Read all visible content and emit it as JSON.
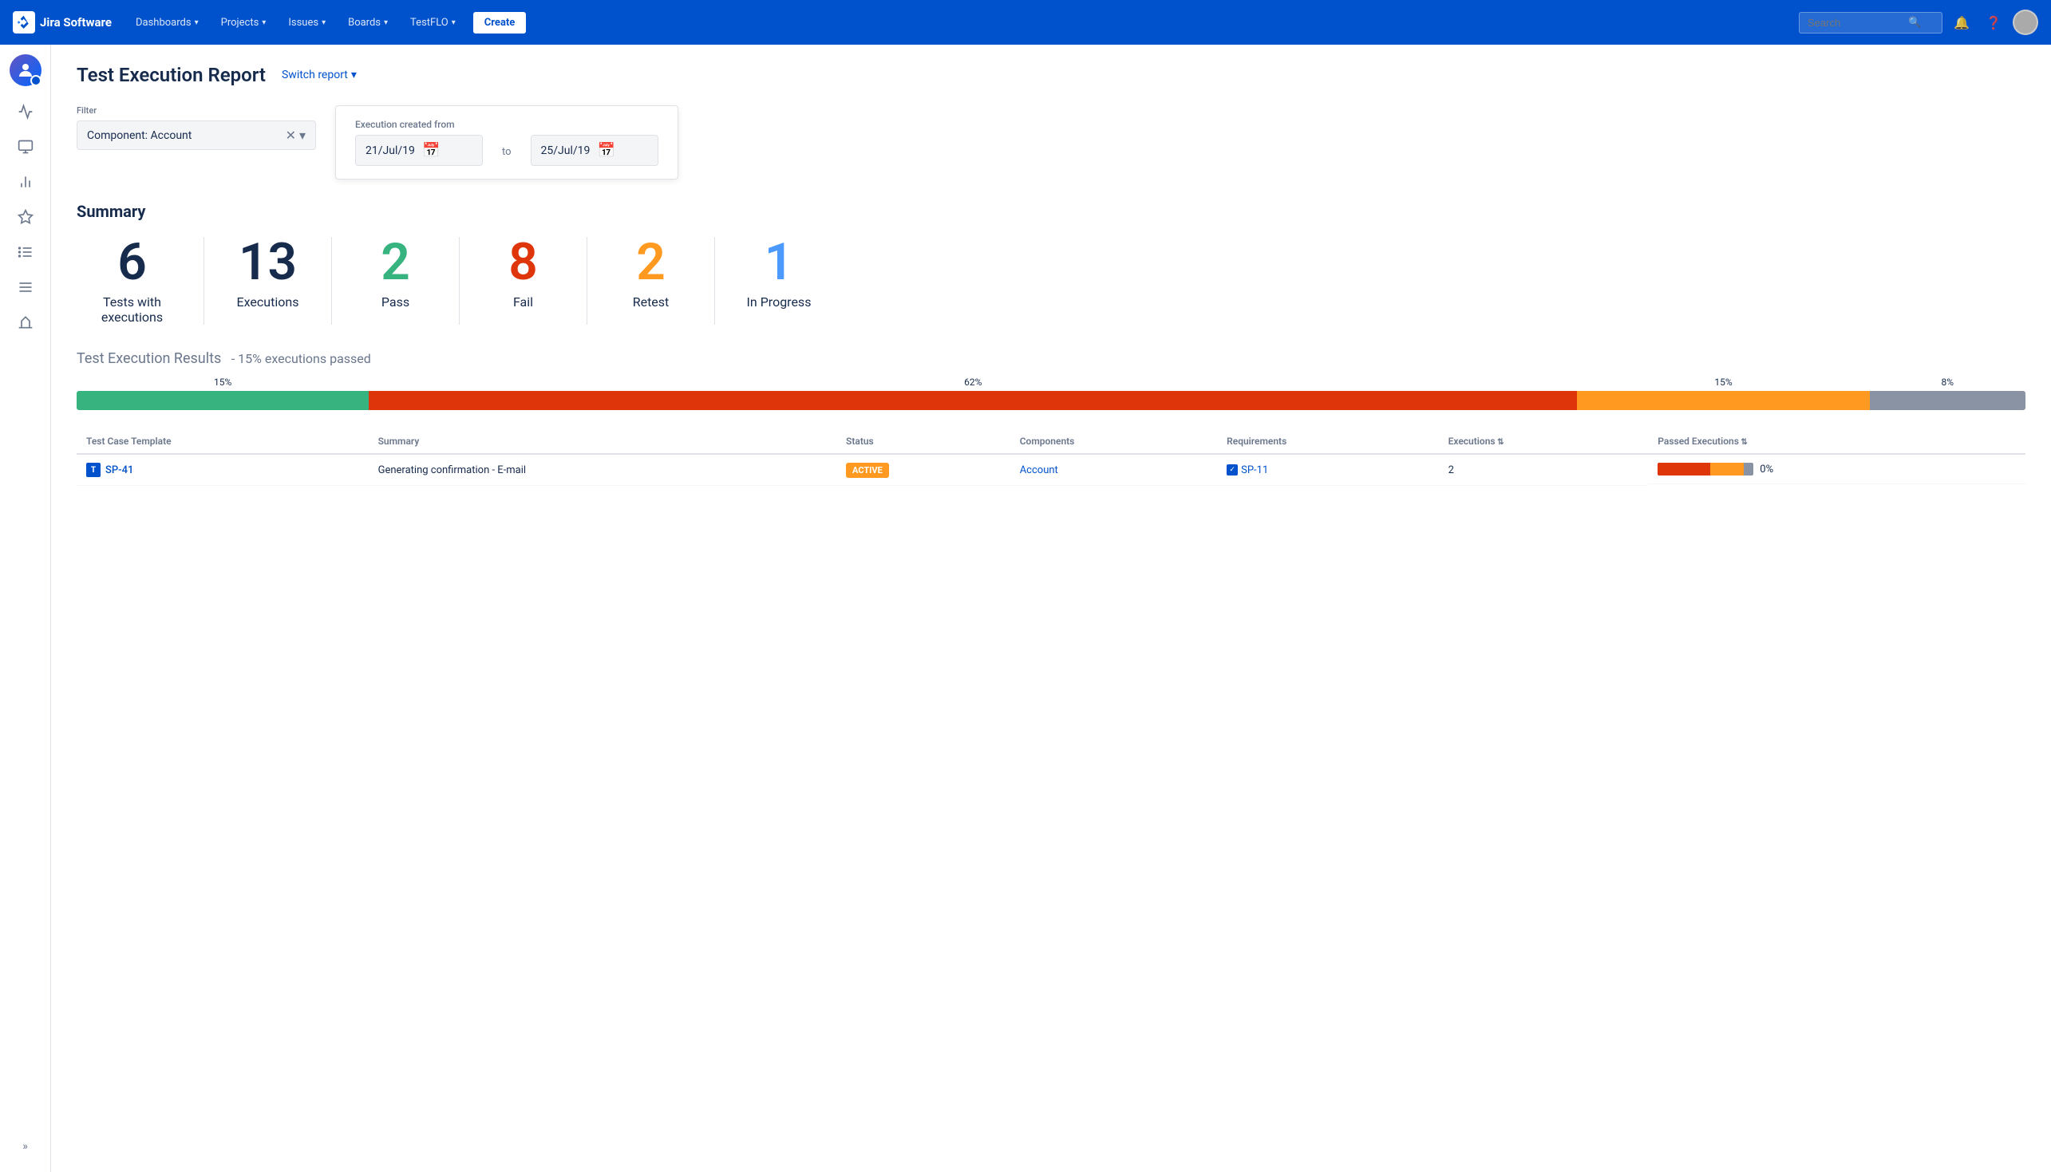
{
  "nav": {
    "logo_text": "Jira Software",
    "items": [
      {
        "label": "Dashboards",
        "has_chevron": true
      },
      {
        "label": "Projects",
        "has_chevron": true
      },
      {
        "label": "Issues",
        "has_chevron": true
      },
      {
        "label": "Boards",
        "has_chevron": true
      },
      {
        "label": "TestFLO",
        "has_chevron": true
      }
    ],
    "create_label": "Create",
    "search_placeholder": "Search"
  },
  "sidebar": {
    "items": [
      {
        "icon": "⚡",
        "label": "activity"
      },
      {
        "icon": "🖥",
        "label": "board"
      },
      {
        "icon": "📈",
        "label": "reports"
      },
      {
        "icon": "🔷",
        "label": "plans"
      },
      {
        "icon": "📊",
        "label": "backlog"
      },
      {
        "icon": "☰",
        "label": "issues"
      },
      {
        "icon": "🏗",
        "label": "deployments"
      }
    ],
    "expand_label": "»"
  },
  "page": {
    "title": "Test Execution Report",
    "switch_report_label": "Switch report",
    "chevron": "▾"
  },
  "filter": {
    "label": "Filter",
    "value": "Component: Account",
    "placeholder": "Component: Account"
  },
  "date_range": {
    "from_label": "Execution created from",
    "from_value": "21/Jul/19",
    "to_label": "to",
    "to_value": "25/Jul/19",
    "calendar_icon": "📅"
  },
  "summary": {
    "title": "Summary",
    "stats": [
      {
        "number": "6",
        "label": "Tests with\nexecutions",
        "color": "black"
      },
      {
        "number": "13",
        "label": "Executions",
        "color": "black"
      },
      {
        "number": "2",
        "label": "Pass",
        "color": "green"
      },
      {
        "number": "8",
        "label": "Fail",
        "color": "red"
      },
      {
        "number": "2",
        "label": "Retest",
        "color": "orange"
      },
      {
        "number": "1",
        "label": "In Progress",
        "color": "blue"
      }
    ]
  },
  "results": {
    "title": "Test Execution Results",
    "subtitle": "- 15% executions passed",
    "bar": [
      {
        "label": "15%",
        "percent": 15,
        "color": "#36b37e"
      },
      {
        "label": "62%",
        "percent": 62,
        "color": "#de350b"
      },
      {
        "label": "15%",
        "percent": 15,
        "color": "#ff991f"
      },
      {
        "label": "8%",
        "percent": 8,
        "color": "#8993a4"
      }
    ]
  },
  "table": {
    "columns": [
      {
        "label": "Test Case Template",
        "sortable": false
      },
      {
        "label": "Summary",
        "sortable": false
      },
      {
        "label": "Status",
        "sortable": false
      },
      {
        "label": "Components",
        "sortable": false
      },
      {
        "label": "Requirements",
        "sortable": false
      },
      {
        "label": "Executions",
        "sortable": true
      },
      {
        "label": "Passed Executions",
        "sortable": true
      }
    ],
    "rows": [
      {
        "id": "SP-41",
        "summary": "Generating confirmation - E-mail",
        "status": "ACTIVE",
        "component": "Account",
        "requirement": "SP-11",
        "executions": "2",
        "passed_pct": "0%",
        "bar_segments": [
          {
            "color": "#de350b",
            "width": 55
          },
          {
            "color": "#ff991f",
            "width": 35
          },
          {
            "color": "#8993a4",
            "width": 10
          }
        ]
      }
    ]
  }
}
